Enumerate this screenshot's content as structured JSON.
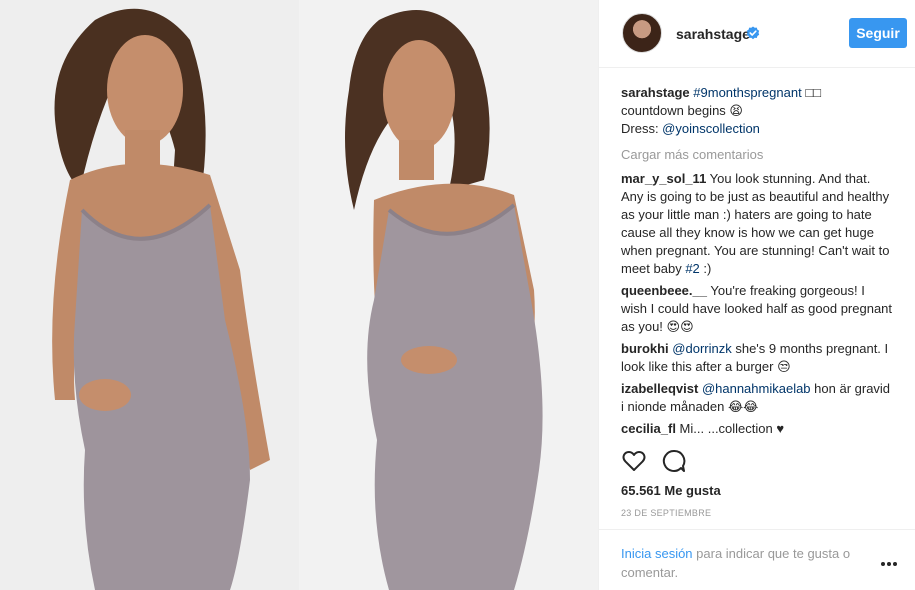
{
  "header": {
    "username": "sarahstage",
    "follow_label": "Seguir"
  },
  "caption": {
    "user": "sarahstage",
    "hashtag": "#9monthspregnant",
    "text_line1": " □□",
    "text_line2": "countdown begins 😫",
    "dress_label": "Dress: ",
    "dress_link": "@yoinscollection"
  },
  "load_more": "Cargar más comentarios",
  "comments": [
    {
      "user": "mar_y_sol_11",
      "text": " You look stunning. And that. Any is going to be just as beautiful and healthy as your little man :) haters are going to hate cause all they know is how we can get huge when pregnant. You are stunning! Can't wait to meet baby ",
      "link": "#2",
      "after": " :)"
    },
    {
      "user": "queenbeee.__",
      "text": " You're freaking gorgeous! I wish I could have looked half as good pregnant as you! 😍😍"
    },
    {
      "user": "burokhi",
      "link": "@dorrinzk",
      "text": " she's 9 months pregnant. I look like this after a burger 😒"
    },
    {
      "user": "izabelleqvist",
      "link": "@hannahmikaelab",
      "text": " hon är gravid i nionde månaden 😂😂"
    },
    {
      "user": "cecilia_fl",
      "text": " Mi... ...collection ♥"
    }
  ],
  "likes": "65.561 Me gusta",
  "date": "23 DE SEPTIEMBRE",
  "login": {
    "link": "Inicia sesión",
    "text": " para indicar que te gusta o comentar."
  },
  "icons": [
    "heart-icon",
    "comment-icon",
    "verified-badge-icon",
    "more-options-icon"
  ],
  "colors": {
    "accent": "#3897f0",
    "link": "#003569",
    "muted": "#999999",
    "text": "#262626"
  }
}
